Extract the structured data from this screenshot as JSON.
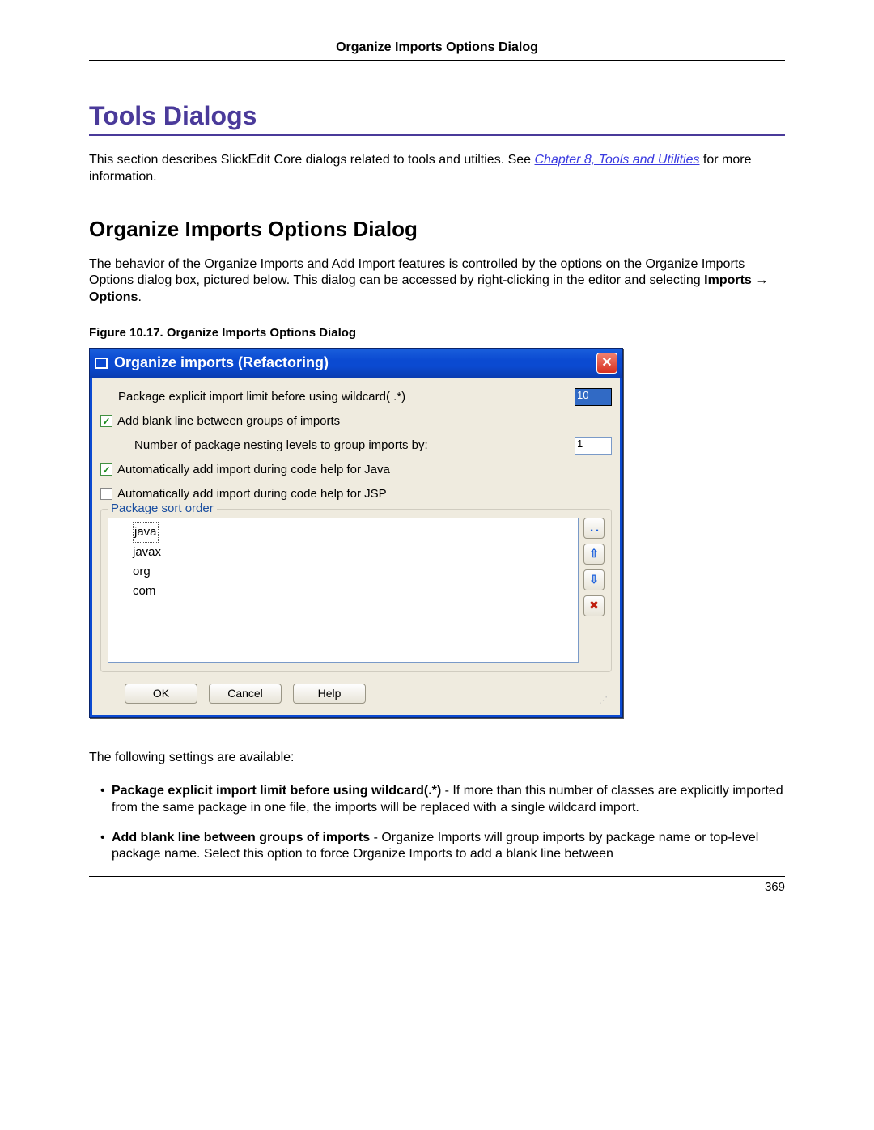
{
  "header": {
    "title": "Organize Imports Options Dialog"
  },
  "h1": "Tools Dialogs",
  "intro": {
    "pre": "This section describes SlickEdit Core dialogs related to tools and utilties. See ",
    "link": "Chapter 8, Tools and Utilities",
    "post": " for more information."
  },
  "h2": "Organize Imports Options Dialog",
  "para2": {
    "pre": "The behavior of the Organize Imports and Add Import features is controlled by the options on the Organize Imports Options dialog box, pictured below. This dialog can be accessed by right-clicking in the editor and selecting ",
    "bold": "Imports → Options",
    "post": "."
  },
  "figure_caption": "Figure 10.17. Organize Imports Options Dialog",
  "dialog": {
    "title": "Organize imports (Refactoring)",
    "row1_label": "Package explicit import limit before using wildcard( .*)",
    "row1_value": "10",
    "row2_label": "Add blank line between groups of imports",
    "row2_checked": true,
    "row3_label": "Number of package nesting levels to group imports by:",
    "row3_value": "1",
    "row4_label": "Automatically add import during code help for Java",
    "row4_checked": true,
    "row5_label": "Automatically add import during code help for JSP",
    "row5_checked": false,
    "sort_legend": "Package sort order",
    "sort_items": [
      "java",
      "javax",
      "org",
      "com"
    ],
    "buttons": {
      "ok": "OK",
      "cancel": "Cancel",
      "help": "Help"
    }
  },
  "settings_intro": "The following settings are available:",
  "bullets": [
    {
      "bold": "Package explicit import limit before using wildcard(.*)",
      "text": " - If more than this number of classes are explicitly imported from the same package in one file, the imports will be replaced with a single wildcard import."
    },
    {
      "bold": "Add blank line between groups of imports",
      "text": " - Organize Imports will group imports by package name or top-level package name. Select this option to force Organize Imports to add a blank line between"
    }
  ],
  "page_number": "369"
}
